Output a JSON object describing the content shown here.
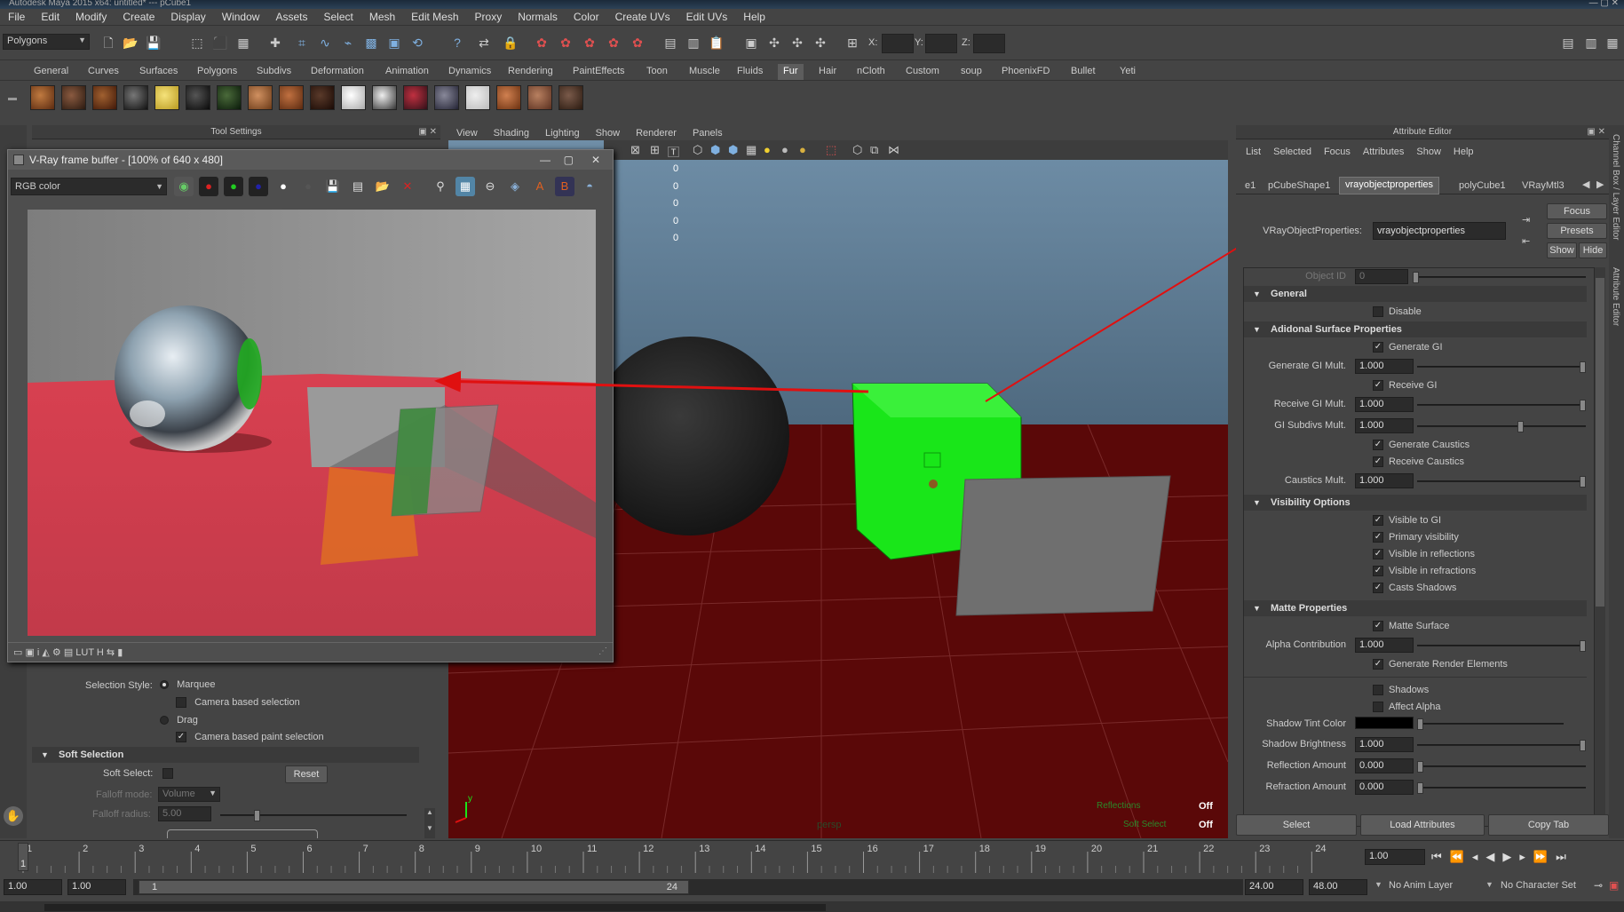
{
  "app": {
    "title": "Autodesk Maya 2015 x64: untitled* --- pCube1"
  },
  "menubar": [
    "File",
    "Edit",
    "Modify",
    "Create",
    "Display",
    "Window",
    "Assets",
    "Select",
    "Mesh",
    "Edit Mesh",
    "Proxy",
    "Normals",
    "Color",
    "Create UVs",
    "Edit UVs",
    "Help"
  ],
  "statusline": {
    "mode": "Polygons",
    "x_label": "X:",
    "y_label": "Y:",
    "z_label": "Z:"
  },
  "shelf": {
    "tabs": [
      "General",
      "Curves",
      "Surfaces",
      "Polygons",
      "Subdivs",
      "Deformation",
      "Animation",
      "Dynamics",
      "Rendering",
      "PaintEffects",
      "Toon",
      "Muscle",
      "Fluids",
      "Fur",
      "Hair",
      "nCloth",
      "Custom",
      "soup",
      "PhoenixFD",
      "Bullet",
      "Yeti"
    ],
    "active_tab": "Fur"
  },
  "tool_settings": {
    "title": "Tool Settings",
    "selection_style_label": "Selection Style:",
    "marquee": "Marquee",
    "camera_based_selection": "Camera based selection",
    "drag": "Drag",
    "camera_based_paint_selection": "Camera based paint selection",
    "soft_selection_header": "Soft Selection",
    "soft_select_label": "Soft Select:",
    "reset": "Reset",
    "falloff_mode_label": "Falloff mode:",
    "falloff_mode_value": "Volume",
    "falloff_radius_label": "Falloff radius:",
    "falloff_radius_value": "5.00"
  },
  "viewport": {
    "menu": [
      "View",
      "Shading",
      "Lighting",
      "Show",
      "Renderer",
      "Panels"
    ],
    "hud_values": [
      "0",
      "0",
      "0",
      "0",
      "0"
    ],
    "hud_off1": "Off",
    "hud_off2": "Off",
    "hud_reflections": "Reflections",
    "hud_soft_select": "Soft Select",
    "camera": "persp"
  },
  "vray_fb": {
    "title": "V-Ray frame buffer - [100% of 640 x 480]",
    "channel": "RGB color"
  },
  "attribute_editor": {
    "title": "Attribute Editor",
    "menu": [
      "List",
      "Selected",
      "Focus",
      "Attributes",
      "Show",
      "Help"
    ],
    "tabs": [
      "e1",
      "pCubeShape1",
      "vrayobjectproperties",
      "polyCube1",
      "VRayMtl3"
    ],
    "active_tab": "vrayobjectproperties",
    "node_label": "VRayObjectProperties:",
    "node_value": "vrayobjectproperties",
    "focus_btn": "Focus",
    "presets_btn": "Presets",
    "show_btn": "Show",
    "hide_btn": "Hide",
    "object_id_label": "Object ID",
    "object_id_value": "0",
    "general_header": "General",
    "disable": "Disable",
    "addl_header": "Adidonal Surface Properties",
    "generate_gi": "Generate GI",
    "generate_gi_mult_label": "Generate GI Mult.",
    "generate_gi_mult": "1.000",
    "receive_gi": "Receive GI",
    "receive_gi_mult_label": "Receive GI Mult.",
    "receive_gi_mult": "1.000",
    "gi_subdivs_label": "GI Subdivs Mult.",
    "gi_subdivs": "1.000",
    "generate_caustics": "Generate Caustics",
    "receive_caustics": "Receive Caustics",
    "caustics_mult_label": "Caustics Mult.",
    "caustics_mult": "1.000",
    "visibility_header": "Visibility Options",
    "visible_to_gi": "Visible to GI",
    "primary_visibility": "Primary visibility",
    "visible_in_reflections": "Visible in reflections",
    "visible_in_refractions": "Visible in refractions",
    "casts_shadows": "Casts Shadows",
    "matte_header": "Matte Properties",
    "matte_surface": "Matte Surface",
    "alpha_contribution_label": "Alpha Contribution",
    "alpha_contribution": "1.000",
    "generate_render_elements": "Generate Render Elements",
    "shadows": "Shadows",
    "affect_alpha": "Affect Alpha",
    "shadow_tint_label": "Shadow Tint Color",
    "shadow_brightness_label": "Shadow Brightness",
    "shadow_brightness": "1.000",
    "reflection_amount_label": "Reflection Amount",
    "reflection_amount": "0.000",
    "refraction_amount_label": "Refraction Amount",
    "refraction_amount": "0.000",
    "select_btn": "Select",
    "load_attributes_btn": "Load Attributes",
    "copy_tab_btn": "Copy Tab"
  },
  "side_strip": {
    "channel_box": "Channel Box / Layer Editor",
    "attribute_editor": "Attribute Editor"
  },
  "timeline": {
    "ticks": [
      "1",
      "2",
      "3",
      "4",
      "5",
      "6",
      "7",
      "8",
      "9",
      "10",
      "11",
      "12",
      "13",
      "14",
      "15",
      "16",
      "17",
      "18",
      "19",
      "20",
      "21",
      "22",
      "23",
      "24"
    ],
    "current_frame_marker": "1",
    "current_time": "1.00"
  },
  "range": {
    "start_time": "1.00",
    "playback_start": "1.00",
    "range_start": "1",
    "range_end": "24",
    "playback_end": "24.00",
    "end_time": "48.00",
    "anim_layer": "No Anim Layer",
    "character_set": "No Character Set"
  },
  "colors": {
    "accent_green": "#19e619",
    "arrow_red": "#e01010",
    "floor_red": "#5a0808",
    "active_tab_blue": "#5285a6"
  }
}
